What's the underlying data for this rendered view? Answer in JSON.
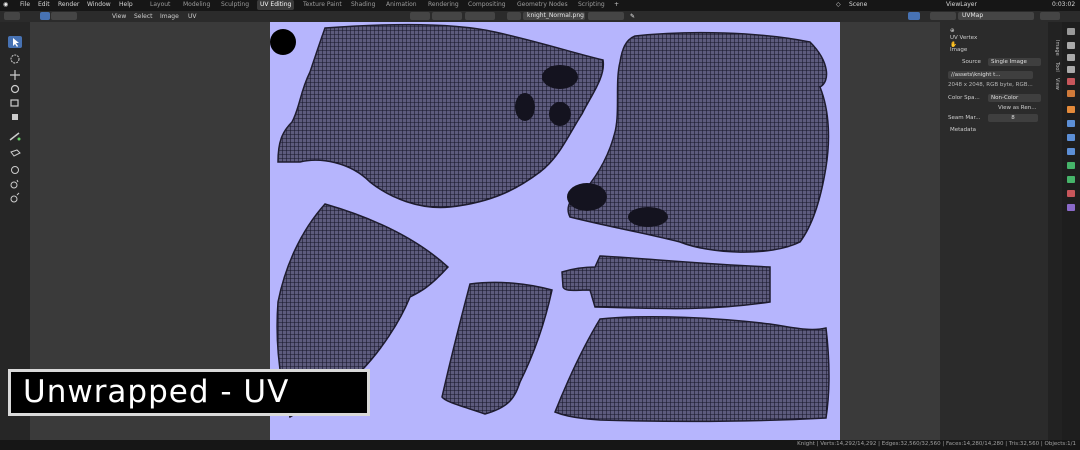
{
  "menus": [
    "File",
    "Edit",
    "Render",
    "Window",
    "Help"
  ],
  "workspaces": [
    "Layout",
    "Modeling",
    "Sculpting",
    "UV Editing",
    "Texture Paint",
    "Shading",
    "Animation",
    "Rendering",
    "Compositing",
    "Geometry Nodes",
    "Scripting"
  ],
  "active_workspace": "UV Editing",
  "add_workspace": "+",
  "scene": "Scene",
  "view_layer": "ViewLayer",
  "time": "0:03:02",
  "editor_menus": [
    "View",
    "Select",
    "Image",
    "UV"
  ],
  "image_name": "knight_Normal.png",
  "uv_map": "UVMap",
  "npanel": {
    "section_uv_vertex": "UV Vertex",
    "section_image": "Image",
    "source_label": "Source",
    "source_value": "Single Image",
    "filepath": "//assets\\knight t...",
    "image_info": "2048 x 2048,  RGB byte,  RGB...",
    "color_space_label": "Color Spa...",
    "color_space_value": "Non-Color",
    "view_as_render": "View as Ren...",
    "seam_margin_label": "Seam Mar...",
    "seam_margin_value": "8",
    "section_metadata": "Metadata"
  },
  "side_tabs": [
    "Image",
    "Tool",
    "View"
  ],
  "status": "Knight | Verts:14,292/14,292 | Edges:32,560/32,560 | Faces:14,280/14,280 | Tris:32,560 | Objects:1/1",
  "caption": "Unwrapped - UV",
  "colors": {
    "accent": "#4772b3",
    "uv_background": "#b6b5fd",
    "viewport_bg": "#3a3a3a"
  },
  "icons": [
    "select-box-icon",
    "cursor-icon",
    "move-icon",
    "rotate-icon",
    "scale-icon",
    "transform-icon",
    "annotate-icon",
    "grab-icon",
    "relax-icon",
    "pinch-icon",
    "rip-icon",
    "zoom-icon",
    "pan-icon"
  ]
}
